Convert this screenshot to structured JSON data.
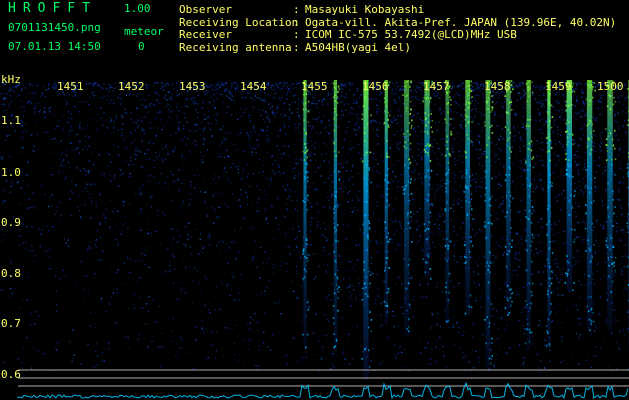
{
  "header": {
    "app_name": "HROFFT",
    "app_version": "1.00",
    "file_name": "0701131450.png",
    "datetime": "07.01.13 14:50",
    "meteor_label": "meteor",
    "meteor_count": "0"
  },
  "station_info": [
    {
      "label": "Observer",
      "value": "Masayuki Kobayashi"
    },
    {
      "label": "Receiving Location",
      "value": "Ogata-vill. Akita-Pref. JAPAN (139.96E, 40.02N)"
    },
    {
      "label": "Receiver",
      "value": "ICOM IC-575 53.7492(@LCD)MHz USB"
    },
    {
      "label": "Receiving antenna",
      "value": "A504HB(yagi 4el)"
    }
  ],
  "spectrogram": {
    "unit": "kHz",
    "y_ticks": [
      "1.1",
      "1.0",
      "0.9",
      "0.8",
      "0.7",
      "0.6"
    ],
    "x_ticks": [
      "1451",
      "1452",
      "1453",
      "1454",
      "1455",
      "1456",
      "1457",
      "1458",
      "1459",
      "1500"
    ],
    "colors": {
      "background": "#000000",
      "noise": "#0a2a99",
      "signal_mid": "#00b4ff",
      "signal_peak": "#7cff3c",
      "label": "#ffff66",
      "title": "#00ff66",
      "ref_line": "#cfcfcf",
      "baseline_trace": "#00c8ff"
    }
  }
}
